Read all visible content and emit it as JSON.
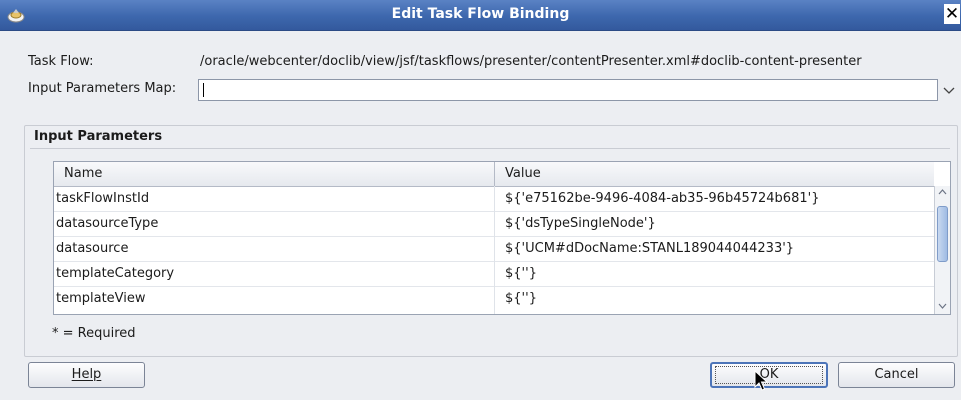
{
  "window": {
    "title": "Edit Task Flow Binding",
    "close_glyph": "✕"
  },
  "form": {
    "task_flow_label": "Task Flow:",
    "task_flow_value": "/oracle/webcenter/doclib/view/jsf/taskflows/presenter/contentPresenter.xml#doclib-content-presenter",
    "input_params_map_label": "Input Parameters Map:",
    "input_params_map_value": ""
  },
  "input_parameters": {
    "section_title": "Input Parameters",
    "columns": [
      "Name",
      "Value"
    ],
    "rows": [
      {
        "name": "taskFlowInstId",
        "value": "${'e75162be-9496-4084-ab35-96b45724b681'}"
      },
      {
        "name": "datasourceType",
        "value": "${'dsTypeSingleNode'}"
      },
      {
        "name": "datasource",
        "value": "${'UCM#dDocName:STANL189044044233'}"
      },
      {
        "name": "templateCategory",
        "value": "${''}"
      },
      {
        "name": "templateView",
        "value": "${''}"
      }
    ],
    "required_note": "* = Required"
  },
  "buttons": {
    "help": "Help",
    "ok": "OK",
    "cancel": "Cancel"
  },
  "colors": {
    "titlebar": "#3d67ad",
    "dialog_bg": "#eceef2",
    "focus_border": "#4c74b8"
  }
}
